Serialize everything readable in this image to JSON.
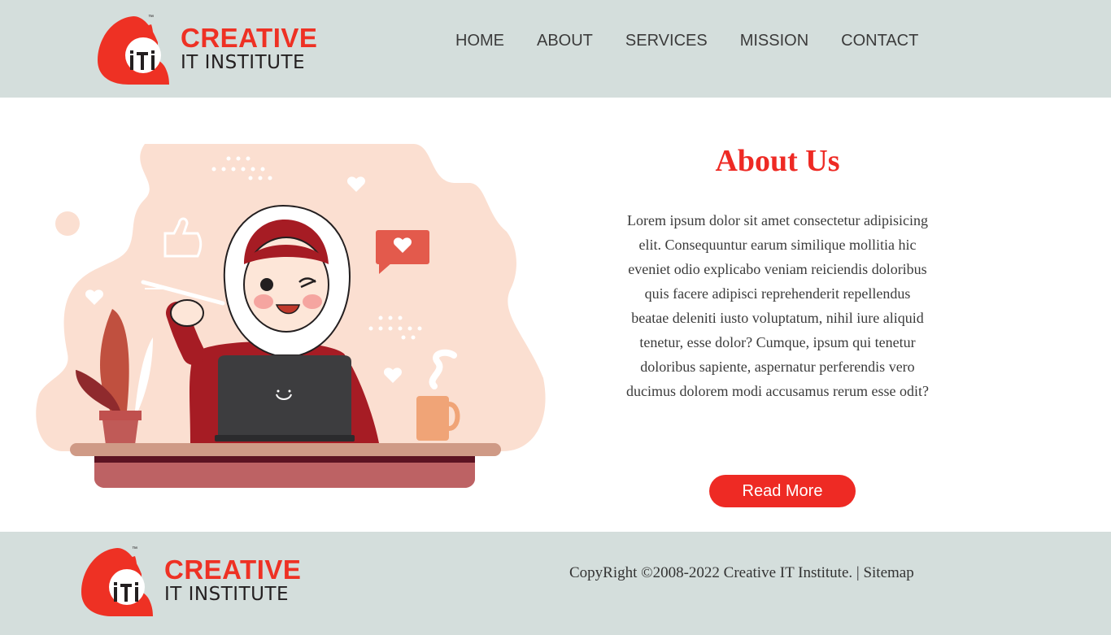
{
  "header": {
    "logo": {
      "line1": "CREATIVE",
      "line2": "IT INSTITUTE",
      "mark_text": "iti",
      "tm": "™"
    },
    "nav": [
      {
        "label": "HOME"
      },
      {
        "label": "ABOUT"
      },
      {
        "label": "SERVICES"
      },
      {
        "label": "MISSION"
      },
      {
        "label": "CONTACT"
      }
    ]
  },
  "about": {
    "title": "About Us",
    "body": "Lorem ipsum dolor sit amet consectetur adipisicing elit. Consequuntur earum similique mollitia hic eveniet odio explicabo veniam reiciendis doloribus quis facere adipisci reprehenderit repellendus beatae deleniti iusto voluptatum, nihil iure aliquid tenetur, esse dolor? Cumque, ipsum qui tenetur doloribus sapiente, aspernatur perferendis vero ducimus dolorem modi accusamus rerum esse odit?",
    "button_label": "Read More"
  },
  "footer": {
    "logo": {
      "line1": "CREATIVE",
      "line2": "IT INSTITUTE",
      "mark_text": "iti",
      "tm": "™"
    },
    "copyright": "CopyRight ©2008-2022 Creative IT Institute.",
    "separator": "|",
    "sitemap_label": "Sitemap"
  },
  "colors": {
    "brand_red": "#ee2a24",
    "header_bg": "#d4dedc",
    "text_dark": "#3b3b3b"
  }
}
